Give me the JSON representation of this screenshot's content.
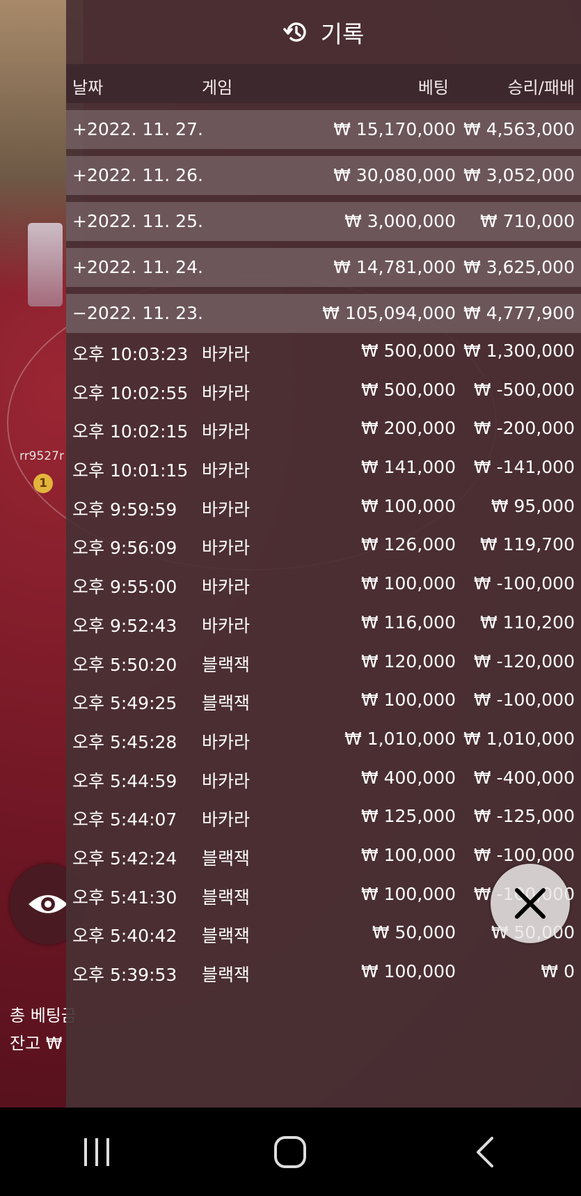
{
  "background": {
    "player_name": "rr9527r",
    "medal_rank": "1",
    "total_bet_label": "총 베팅금",
    "balance_label": "잔고 ₩"
  },
  "panel": {
    "title": "기록",
    "icon": "history-icon",
    "columns": {
      "date": "날짜",
      "game": "게임",
      "bet": "베팅",
      "win": "승리/패배"
    },
    "summary_rows": [
      {
        "date": "+2022. 11. 27.",
        "bet": "₩ 15,170,000",
        "win": "₩ 4,563,000"
      },
      {
        "date": "+2022. 11. 26.",
        "bet": "₩ 30,080,000",
        "win": "₩ 3,052,000"
      },
      {
        "date": "+2022. 11. 25.",
        "bet": "₩ 3,000,000",
        "win": "₩ 710,000"
      },
      {
        "date": "+2022. 11. 24.",
        "bet": "₩ 14,781,000",
        "win": "₩ 3,625,000"
      },
      {
        "date": "−2022. 11. 23.",
        "bet": "₩ 105,094,000",
        "win": "₩ 4,777,900"
      }
    ],
    "detail_rows": [
      {
        "time": "오후 10:03:23",
        "game": "바카라",
        "bet": "₩ 500,000",
        "win": "₩ 1,300,000"
      },
      {
        "time": "오후 10:02:55",
        "game": "바카라",
        "bet": "₩ 500,000",
        "win": "₩ -500,000"
      },
      {
        "time": "오후 10:02:15",
        "game": "바카라",
        "bet": "₩ 200,000",
        "win": "₩ -200,000"
      },
      {
        "time": "오후 10:01:15",
        "game": "바카라",
        "bet": "₩ 141,000",
        "win": "₩ -141,000"
      },
      {
        "time": "오후 9:59:59",
        "game": "바카라",
        "bet": "₩ 100,000",
        "win": "₩ 95,000"
      },
      {
        "time": "오후 9:56:09",
        "game": "바카라",
        "bet": "₩ 126,000",
        "win": "₩ 119,700"
      },
      {
        "time": "오후 9:55:00",
        "game": "바카라",
        "bet": "₩ 100,000",
        "win": "₩ -100,000"
      },
      {
        "time": "오후 9:52:43",
        "game": "바카라",
        "bet": "₩ 116,000",
        "win": "₩ 110,200"
      },
      {
        "time": "오후 5:50:20",
        "game": "블랙잭",
        "bet": "₩ 120,000",
        "win": "₩ -120,000"
      },
      {
        "time": "오후 5:49:25",
        "game": "블랙잭",
        "bet": "₩ 100,000",
        "win": "₩ -100,000"
      },
      {
        "time": "오후 5:45:28",
        "game": "바카라",
        "bet": "₩ 1,010,000",
        "win": "₩ 1,010,000"
      },
      {
        "time": "오후 5:44:59",
        "game": "바카라",
        "bet": "₩ 400,000",
        "win": "₩ -400,000"
      },
      {
        "time": "오후 5:44:07",
        "game": "바카라",
        "bet": "₩ 125,000",
        "win": "₩ -125,000"
      },
      {
        "time": "오후 5:42:24",
        "game": "블랙잭",
        "bet": "₩ 100,000",
        "win": "₩ -100,000"
      },
      {
        "time": "오후 5:41:30",
        "game": "블랙잭",
        "bet": "₩ 100,000",
        "win": "₩ -100,000"
      },
      {
        "time": "오후 5:40:42",
        "game": "블랙잭",
        "bet": "₩ 50,000",
        "win": "₩ 50,000"
      },
      {
        "time": "오후 5:39:53",
        "game": "블랙잭",
        "bet": "₩ 100,000",
        "win": "₩ 0"
      }
    ]
  },
  "buttons": {
    "eye": "eye-icon",
    "close": "close-icon"
  },
  "navbar": {
    "recent": "recent-apps-icon",
    "home": "home-icon",
    "back": "back-icon"
  },
  "colors": {
    "panel_bg": "#48303A",
    "table_red": "#6e1624",
    "gold": "#f4cc2a"
  }
}
